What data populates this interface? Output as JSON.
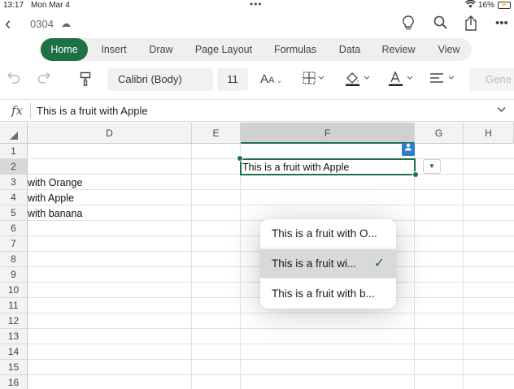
{
  "status_bar": {
    "time": "13:17",
    "date": "Mon Mar 4",
    "battery": "16%"
  },
  "title_bar": {
    "doc_name": "0304"
  },
  "ribbon": {
    "tabs": [
      {
        "label": "Home",
        "active": true
      },
      {
        "label": "Insert",
        "active": false
      },
      {
        "label": "Draw",
        "active": false
      },
      {
        "label": "Page Layout",
        "active": false
      },
      {
        "label": "Formulas",
        "active": false
      },
      {
        "label": "Data",
        "active": false
      },
      {
        "label": "Review",
        "active": false
      },
      {
        "label": "View",
        "active": false
      }
    ]
  },
  "toolbar": {
    "font_name": "Calibri (Body)",
    "font_size": "11",
    "number_format": "Gene"
  },
  "formula_bar": {
    "fx": "fx",
    "content": "This is a fruit with Apple"
  },
  "grid": {
    "columns": [
      "D",
      "E",
      "F",
      "G",
      "H"
    ],
    "selected_column": "F",
    "rows": [
      "1",
      "2",
      "3",
      "4",
      "5",
      "6",
      "7",
      "8",
      "9",
      "10",
      "11",
      "12",
      "13",
      "14",
      "15",
      "16"
    ],
    "selected_row": "2",
    "cells": {
      "D3": "with Orange",
      "D4": "with Apple",
      "D5": "with banana",
      "F2": "This is a fruit with Apple"
    }
  },
  "dropdown": {
    "options": [
      {
        "label": "This is a fruit with O...",
        "selected": false
      },
      {
        "label": "This is a fruit wi...",
        "selected": true
      },
      {
        "label": "This is a fruit with b...",
        "selected": false
      }
    ]
  },
  "colors": {
    "accent": "#1e7145",
    "user_badge": "#2b7cd3"
  }
}
